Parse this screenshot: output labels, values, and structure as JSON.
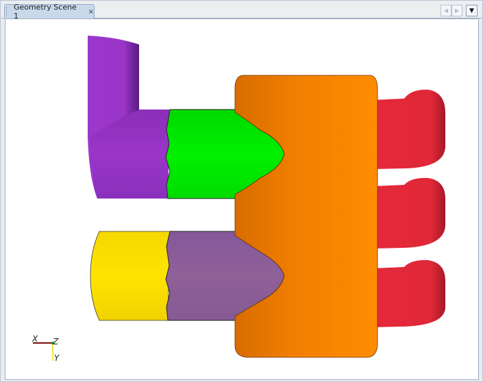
{
  "tab": {
    "title": "Geometry Scene 1",
    "close": "×"
  },
  "controls": {
    "prev": "◀",
    "next": "▶",
    "menu": "▼"
  },
  "axes": {
    "x": "X",
    "y": "Y",
    "z": "Z"
  },
  "colors": {
    "purple": "#9a35c8",
    "green": "#00ee00",
    "yellow": "#f7dc00",
    "mauve": "#8c5e98",
    "orange": "#f58200",
    "red": "#e02838"
  }
}
